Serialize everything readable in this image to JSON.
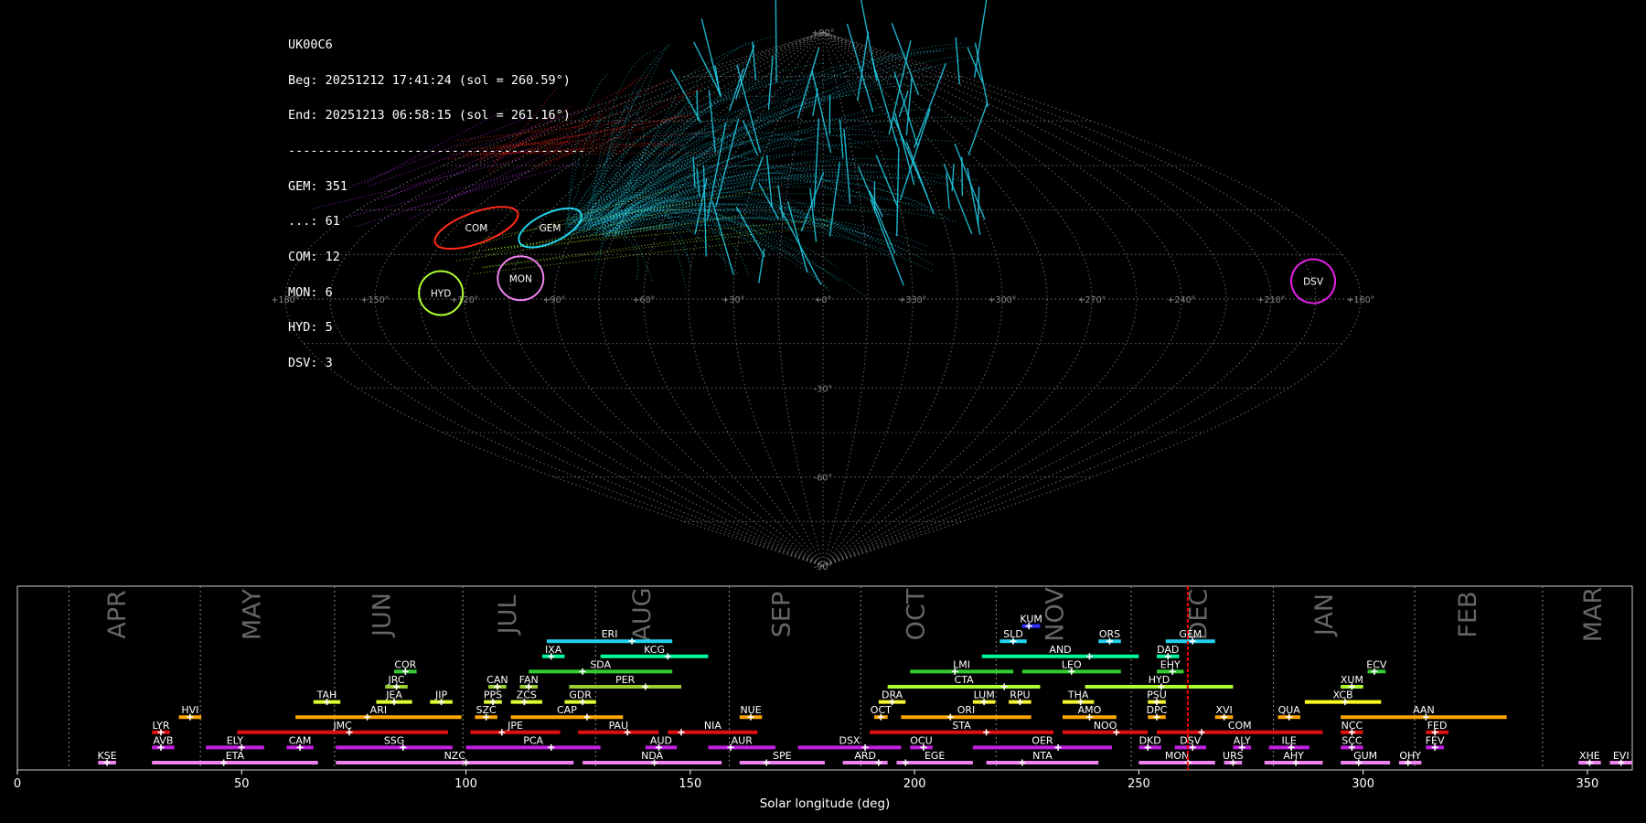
{
  "info_panel": {
    "station": "UK00C6",
    "begin": "Beg: 20251212 17:41:24 (sol = 260.59°)",
    "end": "End: 20251213 06:58:15 (sol = 261.16°)",
    "separator": "----------------------------------------",
    "counts": [
      "GEM: 351",
      "...: 61",
      "COM: 12",
      "MON: 6",
      "HYD: 5",
      "DSV: 3"
    ]
  },
  "sky_map": {
    "projection": "sinusoidal",
    "longitude_labels": [
      {
        "lon": 180,
        "label": "+180°"
      },
      {
        "lon": 150,
        "label": "+150°"
      },
      {
        "lon": 120,
        "label": "+120°"
      },
      {
        "lon": 90,
        "label": "+90°"
      },
      {
        "lon": 60,
        "label": "+60°"
      },
      {
        "lon": 30,
        "label": "+30°"
      },
      {
        "lon": 0,
        "label": "+0°"
      },
      {
        "lon": -30,
        "label": "+330°"
      },
      {
        "lon": -60,
        "label": "+300°"
      },
      {
        "lon": -90,
        "label": "+270°"
      },
      {
        "lon": -120,
        "label": "+240°"
      },
      {
        "lon": -150,
        "label": "+210°"
      },
      {
        "lon": -180,
        "label": "+180°"
      }
    ],
    "latitude_labels": [
      {
        "lat": 90,
        "label": "+90°"
      },
      {
        "lat": -30,
        "label": "-30°"
      },
      {
        "lat": -60,
        "label": "-60°"
      },
      {
        "lat": -90,
        "label": "-90°"
      }
    ],
    "radiants": [
      {
        "code": "COM",
        "lon": 127,
        "lat": 24,
        "color": "#ff2a1a"
      },
      {
        "code": "GEM",
        "lon": 100,
        "lat": 24,
        "color": "#22d3ee"
      },
      {
        "code": "MON",
        "lon": 102,
        "lat": 7,
        "color": "#ee82ee"
      },
      {
        "code": "HYD",
        "lon": 128,
        "lat": 2,
        "color": "#adff2f"
      },
      {
        "code": "DSV",
        "lon": -165,
        "lat": 6,
        "color": "#e020e0"
      }
    ],
    "colors": {
      "grid": "#7f7f7f",
      "gem": "#22d3ee",
      "com": "#ff2a1a",
      "hyd": "#adff2f",
      "dsv": "#cc33ff"
    }
  },
  "chart_data": {
    "type": "bar",
    "title": "",
    "xlabel": "Solar longitude (deg)",
    "ylabel": "",
    "xlim": [
      0,
      360
    ],
    "xticks": [
      0,
      50,
      100,
      150,
      200,
      250,
      300,
      350
    ],
    "current_sol": 260.9,
    "months": [
      {
        "name": "APR",
        "start": 11.5,
        "label_at": 24
      },
      {
        "name": "MAY",
        "start": 40.8,
        "label_at": 54
      },
      {
        "name": "JUN",
        "start": 70.7,
        "label_at": 83
      },
      {
        "name": "JUL",
        "start": 99.3,
        "label_at": 111
      },
      {
        "name": "AUG",
        "start": 128.9,
        "label_at": 141
      },
      {
        "name": "SEP",
        "start": 158.7,
        "label_at": 172
      },
      {
        "name": "OCT",
        "start": 188.0,
        "label_at": 202
      },
      {
        "name": "NOV",
        "start": 218.2,
        "label_at": 233
      },
      {
        "name": "DEC",
        "start": 248.3,
        "label_at": 265
      },
      {
        "name": "JAN",
        "start": 280.0,
        "label_at": 293
      },
      {
        "name": "FEB",
        "start": 311.5,
        "label_at": 325
      },
      {
        "name": "MAR",
        "start": 340.0,
        "label_at": 353
      }
    ],
    "showers": [
      {
        "code": "KUM",
        "start": 224,
        "end": 228,
        "peak": 225.5,
        "row": 10,
        "color": "#3030ff"
      },
      {
        "code": "ERI",
        "start": 118,
        "end": 146,
        "peak": 137,
        "row": 9,
        "color": "#22d3ee"
      },
      {
        "code": "SLD",
        "start": 219,
        "end": 225,
        "peak": 222,
        "row": 9,
        "color": "#22d3ee"
      },
      {
        "code": "ORS",
        "start": 241,
        "end": 246,
        "peak": 243.5,
        "row": 9,
        "color": "#22d3ee"
      },
      {
        "code": "GEM",
        "start": 256,
        "end": 267,
        "peak": 262,
        "row": 9,
        "color": "#22d3ee"
      },
      {
        "code": "IXA",
        "start": 117,
        "end": 122,
        "peak": 119,
        "row": 8,
        "color": "#00fa9a"
      },
      {
        "code": "KCG",
        "start": 130,
        "end": 154,
        "peak": 145,
        "row": 8,
        "color": "#00fa9a"
      },
      {
        "code": "AND",
        "start": 215,
        "end": 250,
        "peak": 239,
        "row": 8,
        "color": "#00fa9a"
      },
      {
        "code": "DAD",
        "start": 254,
        "end": 259,
        "peak": 256.5,
        "row": 8,
        "color": "#00fa9a"
      },
      {
        "code": "COR",
        "start": 84,
        "end": 89,
        "peak": 86.5,
        "row": 7,
        "color": "#32cd32"
      },
      {
        "code": "SDA",
        "start": 114,
        "end": 146,
        "peak": 126,
        "row": 7,
        "color": "#32cd32"
      },
      {
        "code": "LMI",
        "start": 199,
        "end": 222,
        "peak": 209,
        "row": 7,
        "color": "#32cd32"
      },
      {
        "code": "LEO",
        "start": 224,
        "end": 246,
        "peak": 235,
        "row": 7,
        "color": "#32cd32"
      },
      {
        "code": "EHY",
        "start": 254,
        "end": 260,
        "peak": 257.5,
        "row": 7,
        "color": "#32cd32"
      },
      {
        "code": "ECV",
        "start": 301,
        "end": 305,
        "peak": 302.5,
        "row": 7,
        "color": "#32cd32"
      },
      {
        "code": "JRC",
        "start": 82,
        "end": 87,
        "peak": 84.5,
        "row": 6,
        "color": "#9acd32"
      },
      {
        "code": "CAN",
        "start": 105,
        "end": 109,
        "peak": 107,
        "row": 6,
        "color": "#9acd32"
      },
      {
        "code": "FAN",
        "start": 112,
        "end": 116,
        "peak": 114,
        "row": 6,
        "color": "#9acd32"
      },
      {
        "code": "PER",
        "start": 123,
        "end": 148,
        "peak": 140,
        "row": 6,
        "color": "#9acd32"
      },
      {
        "code": "CTA",
        "start": 194,
        "end": 228,
        "peak": 220,
        "row": 6,
        "color": "#adff2f"
      },
      {
        "code": "HYD",
        "start": 238,
        "end": 271,
        "peak": 255,
        "row": 6,
        "color": "#adff2f"
      },
      {
        "code": "XUM",
        "start": 295,
        "end": 300,
        "peak": 297.5,
        "row": 6,
        "color": "#adff2f"
      },
      {
        "code": "TAH",
        "start": 66,
        "end": 72,
        "peak": 69,
        "row": 5,
        "color": "#dfff30"
      },
      {
        "code": "JEA",
        "start": 80,
        "end": 88,
        "peak": 84,
        "row": 5,
        "color": "#dfff30"
      },
      {
        "code": "JIP",
        "start": 92,
        "end": 97,
        "peak": 94.5,
        "row": 5,
        "color": "#dfff30"
      },
      {
        "code": "PPS",
        "start": 104,
        "end": 108,
        "peak": 106,
        "row": 5,
        "color": "#dfff30"
      },
      {
        "code": "ZCS",
        "start": 110,
        "end": 117,
        "peak": 113,
        "row": 5,
        "color": "#dfff30"
      },
      {
        "code": "GDR",
        "start": 122,
        "end": 129,
        "peak": 126,
        "row": 5,
        "color": "#dfff30"
      },
      {
        "code": "DRA",
        "start": 192,
        "end": 198,
        "peak": 195,
        "row": 5,
        "color": "#f5f530"
      },
      {
        "code": "LUM",
        "start": 213,
        "end": 218,
        "peak": 215.5,
        "row": 5,
        "color": "#f5f530"
      },
      {
        "code": "RPU",
        "start": 221,
        "end": 226,
        "peak": 223.5,
        "row": 5,
        "color": "#f5f530"
      },
      {
        "code": "THA",
        "start": 233,
        "end": 240,
        "peak": 237,
        "row": 5,
        "color": "#f5f530"
      },
      {
        "code": "PSU",
        "start": 252,
        "end": 256,
        "peak": 254,
        "row": 5,
        "color": "#f5f530"
      },
      {
        "code": "XCB",
        "start": 287,
        "end": 304,
        "peak": 296,
        "row": 5,
        "color": "#ffff20"
      },
      {
        "code": "HVI",
        "start": 36,
        "end": 41,
        "peak": 38.5,
        "row": 4,
        "color": "#ffa500"
      },
      {
        "code": "ARI",
        "start": 62,
        "end": 99,
        "peak": 78,
        "row": 4,
        "color": "#ffa500"
      },
      {
        "code": "SZC",
        "start": 102,
        "end": 107,
        "peak": 104.5,
        "row": 4,
        "color": "#ffa500"
      },
      {
        "code": "CAP",
        "start": 110,
        "end": 135,
        "peak": 127,
        "row": 4,
        "color": "#ffa500"
      },
      {
        "code": "NUE",
        "start": 161,
        "end": 166,
        "peak": 163.5,
        "row": 4,
        "color": "#ffa500"
      },
      {
        "code": "OCT",
        "start": 191,
        "end": 194,
        "peak": 192.5,
        "row": 4,
        "color": "#ffa500"
      },
      {
        "code": "ORI",
        "start": 197,
        "end": 226,
        "peak": 208,
        "row": 4,
        "color": "#ffa500"
      },
      {
        "code": "AMO",
        "start": 233,
        "end": 245,
        "peak": 239,
        "row": 4,
        "color": "#ffa500"
      },
      {
        "code": "DPC",
        "start": 252,
        "end": 256,
        "peak": 254,
        "row": 4,
        "color": "#ffa500"
      },
      {
        "code": "XVI",
        "start": 267,
        "end": 271,
        "peak": 269,
        "row": 4,
        "color": "#ffa500"
      },
      {
        "code": "QUA",
        "start": 281,
        "end": 286,
        "peak": 283.5,
        "row": 4,
        "color": "#ffa500"
      },
      {
        "code": "AAN",
        "start": 295,
        "end": 332,
        "peak": 314,
        "row": 4,
        "color": "#ffa500"
      },
      {
        "code": "LYR",
        "start": 30,
        "end": 34,
        "peak": 32,
        "row": 3,
        "color": "#e01010"
      },
      {
        "code": "JMC",
        "start": 49,
        "end": 96,
        "peak": 74,
        "row": 3,
        "color": "#e01010"
      },
      {
        "code": "JPE",
        "start": 101,
        "end": 121,
        "peak": 108,
        "row": 3,
        "color": "#e01010"
      },
      {
        "code": "PAU",
        "start": 125,
        "end": 143,
        "peak": 136,
        "row": 3,
        "color": "#e01010"
      },
      {
        "code": "NIA",
        "start": 145,
        "end": 165,
        "peak": 148,
        "row": 3,
        "color": "#e01010"
      },
      {
        "code": "STA",
        "start": 190,
        "end": 231,
        "peak": 216,
        "row": 3,
        "color": "#e01010"
      },
      {
        "code": "NOO",
        "start": 233,
        "end": 252,
        "peak": 245,
        "row": 3,
        "color": "#e01010"
      },
      {
        "code": "COM",
        "start": 254,
        "end": 291,
        "peak": 264,
        "row": 3,
        "color": "#e01010"
      },
      {
        "code": "NCC",
        "start": 295,
        "end": 300,
        "peak": 297.5,
        "row": 3,
        "color": "#e01010"
      },
      {
        "code": "FED",
        "start": 314,
        "end": 319,
        "peak": 316,
        "row": 3,
        "color": "#e01010"
      },
      {
        "code": "AVB",
        "start": 30,
        "end": 35,
        "peak": 32,
        "row": 2,
        "color": "#c020e0"
      },
      {
        "code": "ELY",
        "start": 42,
        "end": 55,
        "peak": 50,
        "row": 2,
        "color": "#c020e0"
      },
      {
        "code": "CAM",
        "start": 60,
        "end": 66,
        "peak": 63,
        "row": 2,
        "color": "#c020e0"
      },
      {
        "code": "SSG",
        "start": 71,
        "end": 97,
        "peak": 86,
        "row": 2,
        "color": "#c020e0"
      },
      {
        "code": "PCA",
        "start": 100,
        "end": 130,
        "peak": 119,
        "row": 2,
        "color": "#c020e0"
      },
      {
        "code": "AUD",
        "start": 140,
        "end": 147,
        "peak": 143,
        "row": 2,
        "color": "#c020e0"
      },
      {
        "code": "AUR",
        "start": 154,
        "end": 169,
        "peak": 159,
        "row": 2,
        "color": "#c020e0"
      },
      {
        "code": "DSX",
        "start": 174,
        "end": 197,
        "peak": 189,
        "row": 2,
        "color": "#c020e0"
      },
      {
        "code": "OCU",
        "start": 199,
        "end": 204,
        "peak": 202,
        "row": 2,
        "color": "#c020e0"
      },
      {
        "code": "OER",
        "start": 213,
        "end": 244,
        "peak": 232,
        "row": 2,
        "color": "#c020e0"
      },
      {
        "code": "DKD",
        "start": 250,
        "end": 255,
        "peak": 252,
        "row": 2,
        "color": "#c020e0"
      },
      {
        "code": "DSV",
        "start": 258,
        "end": 265,
        "peak": 262,
        "row": 2,
        "color": "#c020e0"
      },
      {
        "code": "ALY",
        "start": 271,
        "end": 275,
        "peak": 273,
        "row": 2,
        "color": "#c020e0"
      },
      {
        "code": "ILE",
        "start": 279,
        "end": 288,
        "peak": 284,
        "row": 2,
        "color": "#c020e0"
      },
      {
        "code": "SCC",
        "start": 295,
        "end": 300,
        "peak": 297.5,
        "row": 2,
        "color": "#c020e0"
      },
      {
        "code": "FEV",
        "start": 314,
        "end": 318,
        "peak": 316,
        "row": 2,
        "color": "#c020e0"
      },
      {
        "code": "KSE",
        "start": 18,
        "end": 22,
        "peak": 20,
        "row": 1,
        "color": "#ee82ee"
      },
      {
        "code": "ETA",
        "start": 30,
        "end": 67,
        "peak": 46,
        "row": 1,
        "color": "#ee82ee"
      },
      {
        "code": "NZC",
        "start": 71,
        "end": 124,
        "peak": 100,
        "row": 1,
        "color": "#ee82ee"
      },
      {
        "code": "NDA",
        "start": 126,
        "end": 157,
        "peak": 142,
        "row": 1,
        "color": "#ee82ee"
      },
      {
        "code": "SPE",
        "start": 161,
        "end": 180,
        "peak": 167,
        "row": 1,
        "color": "#ee82ee"
      },
      {
        "code": "ARD",
        "start": 184,
        "end": 194,
        "peak": 192,
        "row": 1,
        "color": "#ee82ee"
      },
      {
        "code": "EGE",
        "start": 196,
        "end": 213,
        "peak": 198,
        "row": 1,
        "color": "#ee82ee"
      },
      {
        "code": "NTA",
        "start": 216,
        "end": 241,
        "peak": 224,
        "row": 1,
        "color": "#ee82ee"
      },
      {
        "code": "MON",
        "start": 250,
        "end": 267,
        "peak": 261,
        "row": 1,
        "color": "#ee82ee"
      },
      {
        "code": "URS",
        "start": 269,
        "end": 273,
        "peak": 271,
        "row": 1,
        "color": "#ee82ee"
      },
      {
        "code": "AHY",
        "start": 278,
        "end": 291,
        "peak": 285,
        "row": 1,
        "color": "#ee82ee"
      },
      {
        "code": "GUM",
        "start": 295,
        "end": 306,
        "peak": 299,
        "row": 1,
        "color": "#ee82ee"
      },
      {
        "code": "OHY",
        "start": 308,
        "end": 313,
        "peak": 310,
        "row": 1,
        "color": "#ee82ee"
      },
      {
        "code": "XHE",
        "start": 348,
        "end": 353,
        "peak": 350.5,
        "row": 1,
        "color": "#ee82ee"
      },
      {
        "code": "EVI",
        "start": 355,
        "end": 360,
        "peak": 357.5,
        "row": 1,
        "color": "#ee82ee"
      }
    ],
    "colors": {
      "frame": "#cccccc",
      "month_grid": "#888888",
      "month_label": "#666666",
      "current_sol": "#ff0000",
      "text": "#ffffff"
    }
  }
}
